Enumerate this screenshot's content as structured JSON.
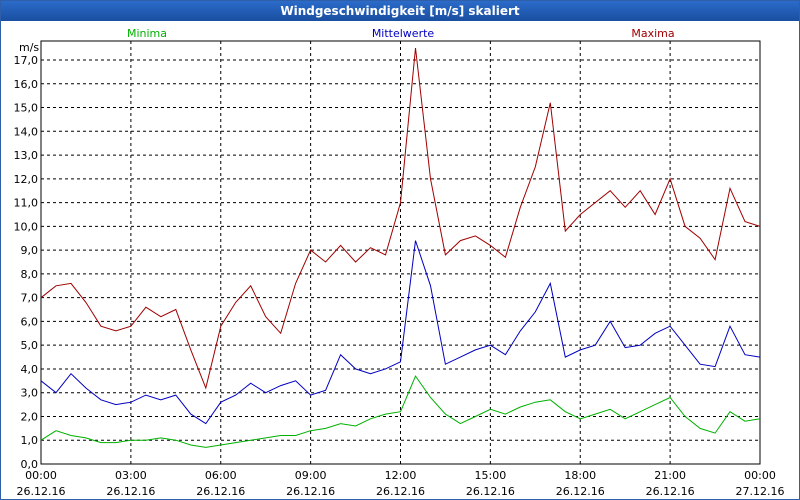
{
  "window": {
    "title": "Windgeschwindigkeit [m/s] skaliert"
  },
  "chart_data": {
    "type": "line",
    "ylabel": "m/s",
    "ylim": [
      0,
      17.8
    ],
    "yticks": [
      "0,0",
      "1,0",
      "2,0",
      "3,0",
      "4,0",
      "5,0",
      "6,0",
      "7,0",
      "8,0",
      "9,0",
      "10,0",
      "11,0",
      "12,0",
      "13,0",
      "14,0",
      "15,0",
      "16,0",
      "17,0"
    ],
    "x_ticks": [
      {
        "time": "00:00",
        "date": "26.12.16"
      },
      {
        "time": "03:00",
        "date": "26.12.16"
      },
      {
        "time": "06:00",
        "date": "26.12.16"
      },
      {
        "time": "09:00",
        "date": "26.12.16"
      },
      {
        "time": "12:00",
        "date": "26.12.16"
      },
      {
        "time": "15:00",
        "date": "26.12.16"
      },
      {
        "time": "18:00",
        "date": "26.12.16"
      },
      {
        "time": "21:00",
        "date": "26.12.16"
      },
      {
        "time": "00:00",
        "date": "27.12.16"
      }
    ],
    "grid": true,
    "x_hours": [
      0,
      0.5,
      1,
      1.5,
      2,
      2.5,
      3,
      3.5,
      4,
      4.5,
      5,
      5.5,
      6,
      6.5,
      7,
      7.5,
      8,
      8.5,
      9,
      9.5,
      10,
      10.5,
      11,
      11.5,
      12,
      12.5,
      13,
      13.5,
      14,
      14.5,
      15,
      15.5,
      16,
      16.5,
      17,
      17.5,
      18,
      18.5,
      19,
      19.5,
      20,
      20.5,
      21,
      21.5,
      22,
      22.5,
      23,
      23.5,
      24
    ],
    "series": [
      {
        "name": "Minima",
        "color": "#00b000",
        "values": [
          1.0,
          1.4,
          1.2,
          1.1,
          0.9,
          0.9,
          1.0,
          1.0,
          1.1,
          1.0,
          0.8,
          0.7,
          0.8,
          0.9,
          1.0,
          1.1,
          1.2,
          1.2,
          1.4,
          1.5,
          1.7,
          1.6,
          1.9,
          2.1,
          2.2,
          3.7,
          2.8,
          2.1,
          1.7,
          2.0,
          2.3,
          2.1,
          2.4,
          2.6,
          2.7,
          2.2,
          1.9,
          2.1,
          2.3,
          1.9,
          2.2,
          2.5,
          2.8,
          2.0,
          1.5,
          1.3,
          2.2,
          1.8,
          1.9
        ]
      },
      {
        "name": "Mittelwerte",
        "color": "#0000c0",
        "values": [
          3.5,
          3.0,
          3.8,
          3.2,
          2.7,
          2.5,
          2.6,
          2.9,
          2.7,
          2.9,
          2.1,
          1.7,
          2.6,
          2.9,
          3.4,
          3.0,
          3.3,
          3.5,
          2.9,
          3.1,
          4.6,
          4.0,
          3.8,
          4.0,
          4.3,
          9.4,
          7.5,
          4.2,
          4.5,
          4.8,
          5.0,
          4.6,
          5.6,
          6.4,
          7.6,
          4.5,
          4.8,
          5.0,
          6.0,
          4.9,
          5.0,
          5.5,
          5.8,
          5.0,
          4.2,
          4.1,
          5.8,
          4.6,
          4.5
        ]
      },
      {
        "name": "Maxima",
        "color": "#a00000",
        "values": [
          7.0,
          7.5,
          7.6,
          6.8,
          5.8,
          5.6,
          5.8,
          6.6,
          6.2,
          6.5,
          4.8,
          3.2,
          5.8,
          6.8,
          7.5,
          6.2,
          5.5,
          7.6,
          9.0,
          8.5,
          9.2,
          8.5,
          9.1,
          8.8,
          11.0,
          17.5,
          12.0,
          8.8,
          9.4,
          9.6,
          9.2,
          8.7,
          10.8,
          12.5,
          15.2,
          9.8,
          10.5,
          11.0,
          11.5,
          10.8,
          11.5,
          10.5,
          12.0,
          10.0,
          9.5,
          8.6,
          11.6,
          10.2,
          10.0
        ]
      }
    ]
  }
}
